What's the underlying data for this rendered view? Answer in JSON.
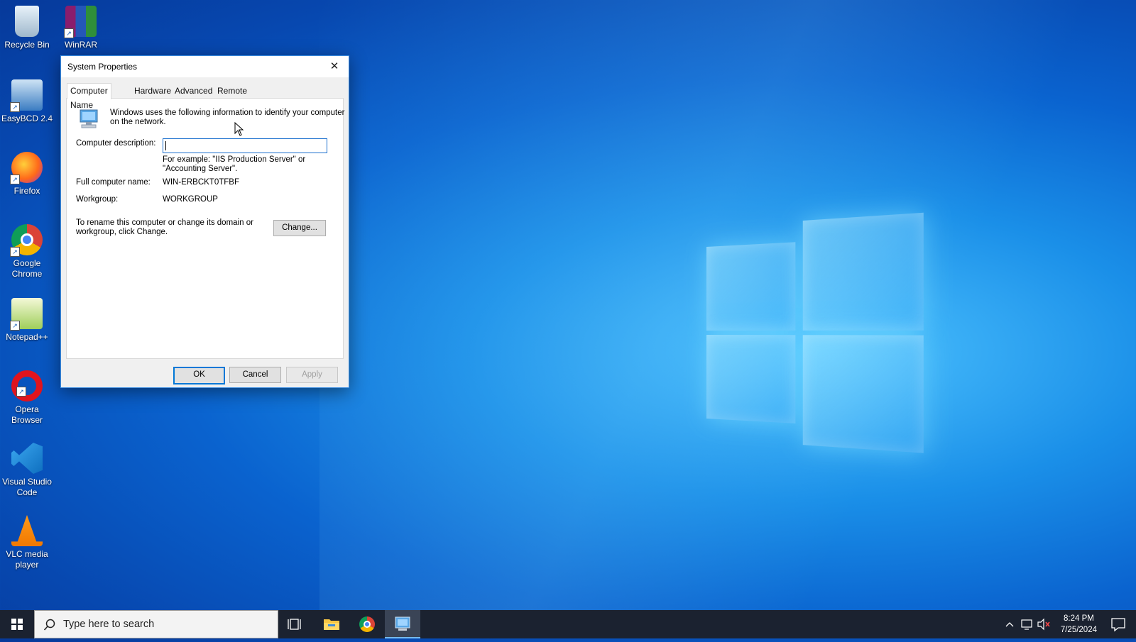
{
  "desktop": {
    "icons": [
      {
        "label": "Recycle Bin",
        "icon": "recycle-bin-icon"
      },
      {
        "label": "WinRAR",
        "icon": "winrar-icon"
      },
      {
        "label": "EasyBCD 2.4",
        "icon": "easybcd-icon"
      },
      {
        "label": "Firefox",
        "icon": "firefox-icon"
      },
      {
        "label": "Google Chrome",
        "icon": "chrome-icon"
      },
      {
        "label": "Notepad++",
        "icon": "notepadpp-icon"
      },
      {
        "label": "Opera Browser",
        "icon": "opera-icon"
      },
      {
        "label": "Visual Studio Code",
        "icon": "vscode-icon"
      },
      {
        "label": "VLC media player",
        "icon": "vlc-icon"
      }
    ]
  },
  "dialog": {
    "title": "System Properties",
    "close_glyph": "✕",
    "tabs": [
      {
        "label": "Computer Name",
        "active": true
      },
      {
        "label": "Hardware",
        "active": false
      },
      {
        "label": "Advanced",
        "active": false
      },
      {
        "label": "Remote",
        "active": false
      }
    ],
    "intro_line1": "Windows uses the following information to identify your computer",
    "intro_line2": "on the network.",
    "description_label": "Computer description:",
    "description_value": "",
    "example_line1": "For example: \"IIS Production Server\" or",
    "example_line2": "\"Accounting Server\".",
    "full_name_label": "Full computer name:",
    "full_name_value": "WIN-ERBCKT0TFBF",
    "workgroup_label": "Workgroup:",
    "workgroup_value": "WORKGROUP",
    "rename_line1": "To rename this computer or change its domain or",
    "rename_line2": "workgroup, click Change.",
    "change_button": "Change...",
    "ok_button": "OK",
    "cancel_button": "Cancel",
    "apply_button": "Apply"
  },
  "taskbar": {
    "search_placeholder": "Type here to search",
    "time": "8:24 PM",
    "date": "7/25/2024"
  },
  "colors": {
    "accent": "#0078d7",
    "taskbar": "#1b2230"
  }
}
